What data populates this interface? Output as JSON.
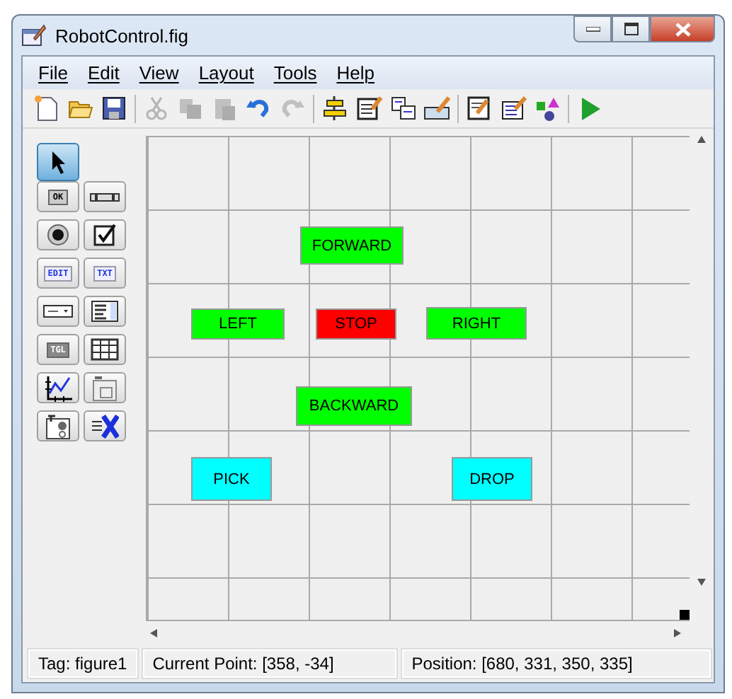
{
  "window": {
    "title": "RobotControl.fig"
  },
  "menu": [
    "File",
    "Edit",
    "View",
    "Layout",
    "Tools",
    "Help"
  ],
  "toolbar": [
    [
      {
        "kind": "new",
        "disabled": false
      },
      {
        "kind": "open",
        "disabled": false
      },
      {
        "kind": "save",
        "disabled": false
      }
    ],
    [
      {
        "kind": "cut",
        "disabled": true
      },
      {
        "kind": "copy",
        "disabled": true
      },
      {
        "kind": "paste",
        "disabled": true
      },
      {
        "kind": "undo",
        "disabled": false
      },
      {
        "kind": "redo",
        "disabled": true
      }
    ],
    [
      {
        "kind": "align",
        "disabled": false
      },
      {
        "kind": "menu-editor",
        "disabled": false
      },
      {
        "kind": "tab-order",
        "disabled": false
      },
      {
        "kind": "toolbar-editor",
        "disabled": false
      }
    ],
    [
      {
        "kind": "editor",
        "disabled": false
      },
      {
        "kind": "inspector",
        "disabled": false
      },
      {
        "kind": "browser",
        "disabled": false
      }
    ],
    [
      {
        "kind": "run",
        "disabled": false
      }
    ]
  ],
  "palette": [
    {
      "kind": "select",
      "selected": true
    },
    {
      "kind": "pushbutton",
      "label": "OK",
      "selected": false
    },
    {
      "kind": "slider",
      "selected": false
    },
    {
      "kind": "radio",
      "selected": false
    },
    {
      "kind": "checkbox",
      "selected": false
    },
    {
      "kind": "edit",
      "label": "EDIT",
      "selected": false
    },
    {
      "kind": "text",
      "label": "TXT",
      "selected": false
    },
    {
      "kind": "popup",
      "selected": false
    },
    {
      "kind": "listbox",
      "selected": false
    },
    {
      "kind": "toggle",
      "label": "TGL",
      "selected": false
    },
    {
      "kind": "table",
      "selected": false
    },
    {
      "kind": "axes",
      "selected": false
    },
    {
      "kind": "panel",
      "selected": false
    },
    {
      "kind": "buttongroup",
      "selected": false
    },
    {
      "kind": "activex",
      "selected": false
    }
  ],
  "canvas": {
    "components": [
      {
        "label": "FORWARD",
        "color": "#00ff00"
      },
      {
        "label": "LEFT",
        "color": "#00ff00"
      },
      {
        "label": "STOP",
        "color": "#ff0000"
      },
      {
        "label": "RIGHT",
        "color": "#00ff00"
      },
      {
        "label": "BACKWARD",
        "color": "#00ff00"
      },
      {
        "label": "PICK",
        "color": "#00ffff"
      },
      {
        "label": "DROP",
        "color": "#00ffff"
      }
    ]
  },
  "status_bar": [
    "Tag: figure1",
    "Current Point:  [358, -34]",
    "Position: [680, 331, 350, 335]"
  ]
}
